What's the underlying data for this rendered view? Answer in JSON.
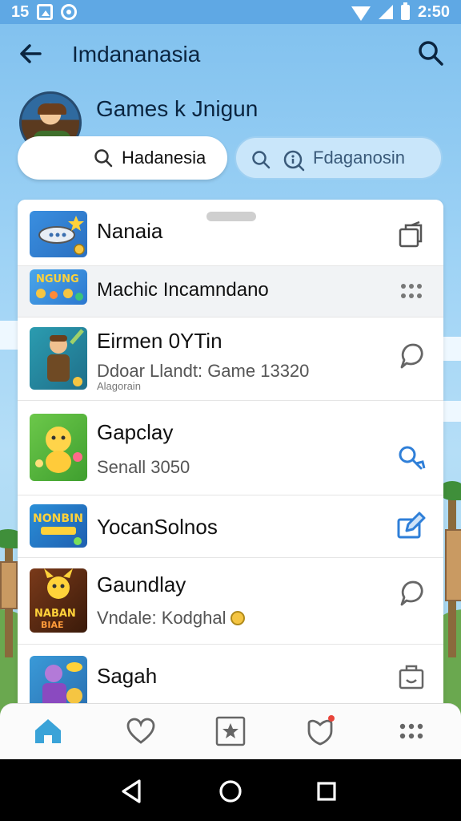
{
  "status_bar": {
    "time_left": "15",
    "time_right": "2:50"
  },
  "app_bar": {
    "title": "Imdananasia",
    "back_icon": "arrow-left-icon",
    "search_icon": "search-icon"
  },
  "profile": {
    "title": "Games k Jnigun",
    "avatar_icon": "character-avatar"
  },
  "search_chips": [
    {
      "label": "Hadanesia",
      "icon": "search-icon"
    },
    {
      "label": "Fdaganosin",
      "icon": "search-icon"
    }
  ],
  "games": [
    {
      "title": "Nanaia",
      "subtitle": "",
      "tiny": "",
      "action_icon": "open-external-icon"
    },
    {
      "title": "Machic Incamndano",
      "subtitle": "",
      "tiny": "",
      "action_icon": "more-dots-icon"
    },
    {
      "title": "Eirmen 0YTin",
      "subtitle": "Ddoar Llandt: Game 13320",
      "tiny": "Alagorain",
      "action_icon": "chat-bubble-icon"
    },
    {
      "title": "Gapclay",
      "subtitle": "Senall 3050",
      "tiny": "",
      "action_icon": "search-link-icon"
    },
    {
      "title": "YocanSolnos",
      "subtitle": "",
      "tiny": "",
      "action_icon": "edit-icon"
    },
    {
      "title": "Gaundlay",
      "subtitle": "Vndale: Kodghal",
      "tiny": "",
      "action_icon": "chat-bubble-icon"
    },
    {
      "title": "Sagah",
      "subtitle": "",
      "tiny": "",
      "action_icon": "briefcase-icon"
    }
  ],
  "bottom_nav": [
    {
      "icon": "home-icon",
      "active": true
    },
    {
      "icon": "heart-icon",
      "active": false
    },
    {
      "icon": "star-box-icon",
      "active": false
    },
    {
      "icon": "shield-heart-icon",
      "active": false
    },
    {
      "icon": "grid-dots-icon",
      "active": false
    }
  ],
  "colors": {
    "accent": "#2f7fd8",
    "status_bar": "#5fa8e4",
    "home_active": "#3aa3d8"
  }
}
